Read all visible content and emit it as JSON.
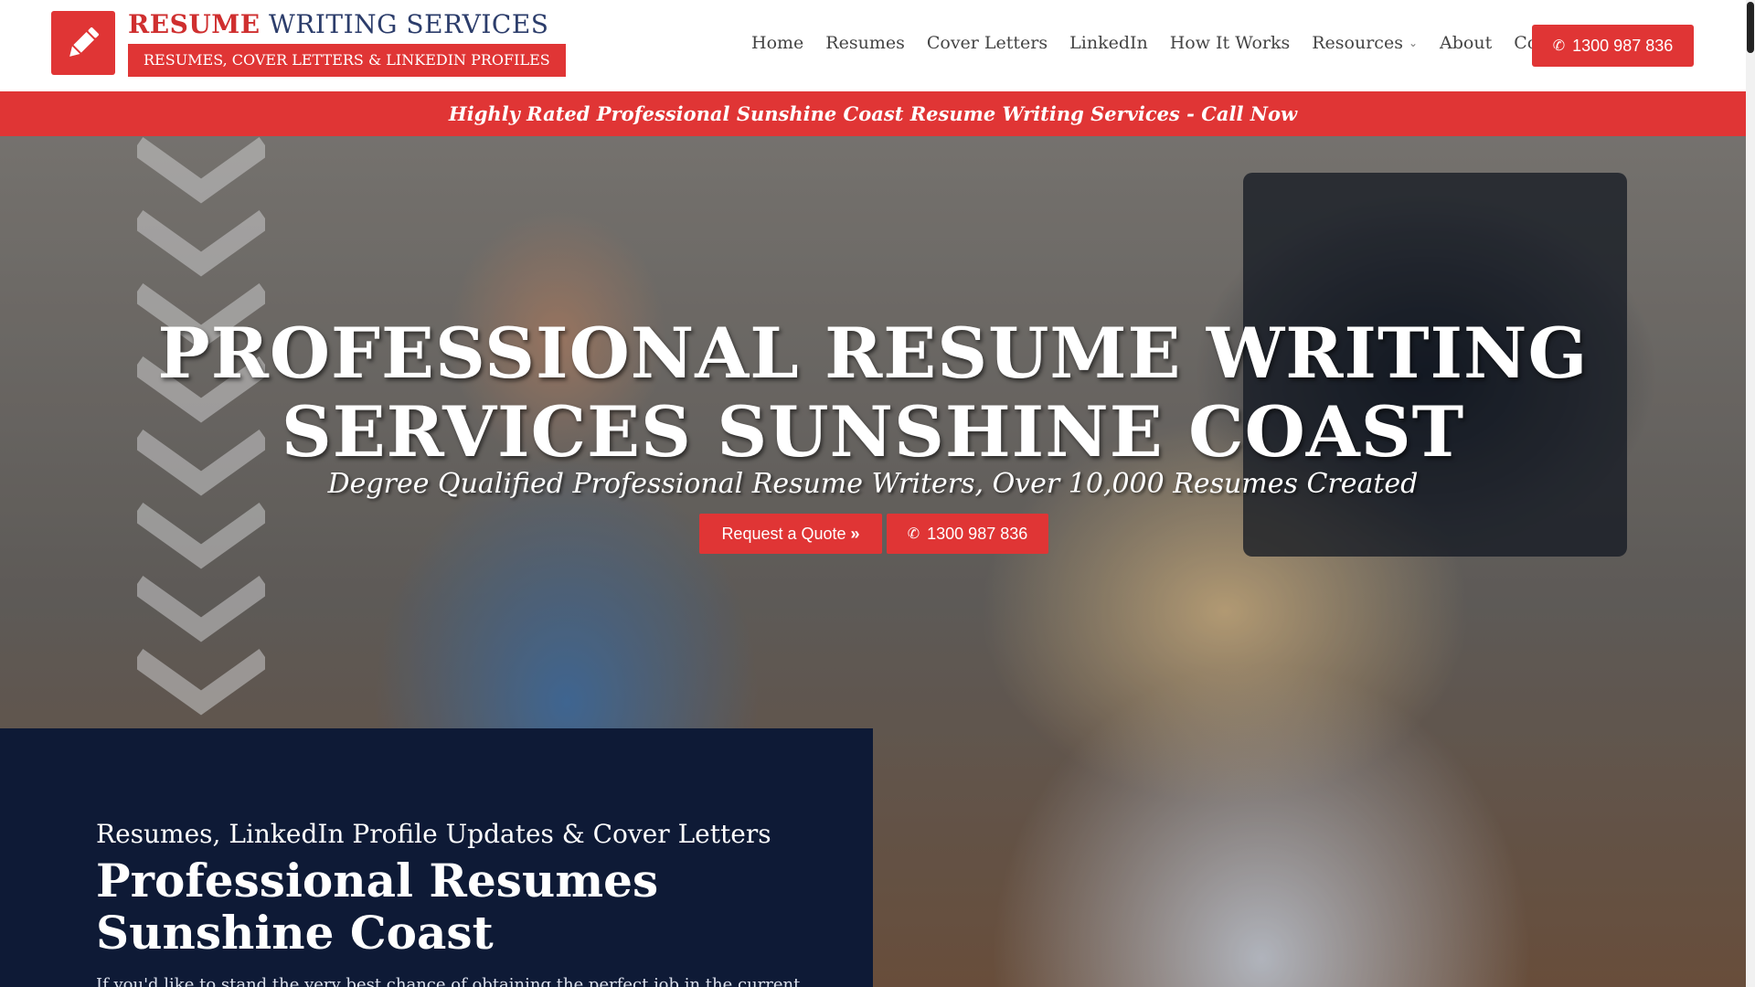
{
  "brand": {
    "title_bold": "RESUME",
    "title_rest": " WRITING SERVICES",
    "tagline": "RESUMES, COVER LETTERS & LINKEDIN PROFILES",
    "logo_icon": "pencil-icon"
  },
  "nav": {
    "items": [
      {
        "label": "Home"
      },
      {
        "label": "Resumes"
      },
      {
        "label": "Cover Letters"
      },
      {
        "label": "LinkedIn"
      },
      {
        "label": "How It Works"
      },
      {
        "label": "Resources",
        "has_dropdown": true
      },
      {
        "label": "About"
      },
      {
        "label": "Contact"
      }
    ],
    "cta_phone": "1300 987 836"
  },
  "announcement": "Highly Rated Professional Sunshine Coast Resume Writing Services - Call Now",
  "hero": {
    "title_line1": "PROFESSIONAL RESUME WRITING",
    "title_line2": "SERVICES SUNSHINE COAST",
    "subtitle": "Degree Qualified Professional Resume Writers, Over 10,000 Resumes Created",
    "quote_button": "Request a Quote",
    "phone_button": "1300 987 836"
  },
  "intro": {
    "kicker": "Resumes, LinkedIn Profile Updates & Cover Letters",
    "title": "Professional Resumes Sunshine Coast",
    "body": "If you'd like to stand the very best chance of obtaining the perfect job in the current"
  },
  "colors": {
    "accent_red": "#e03535",
    "navy": "#0e1a36",
    "brand_blue": "#2c3d6b"
  }
}
